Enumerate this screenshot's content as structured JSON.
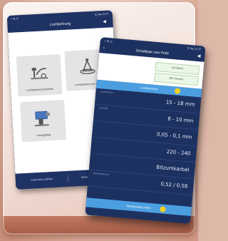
{
  "phone_left": {
    "status_left": "≈ ⊕ ⊙",
    "status_right": "◫ ▾▴ 11:27",
    "title": "Lochbohrung",
    "volume_icon": "speaker-icon",
    "tiles": [
      {
        "label": "Lochabstand Schalbrett",
        "icon": "pipe-bracket-icon"
      },
      {
        "label": "Lochabstand vom Profil",
        "icon": "profile-cone-icon"
      },
      {
        "label": "Kreisgebirge",
        "icon": "drill-machine-icon"
      }
    ],
    "bottom": {
      "left": "Laterstutzt wählen",
      "right": "Berechnungsmethode"
    }
  },
  "phone_right": {
    "status_left": "≈ ⊕ ⊙",
    "status_right": "◫ ▾▴ 11:27",
    "title": "Schalltippe vom Profil",
    "back_icon": "back-arrow-icon",
    "volume_icon": "speaker-icon",
    "fields": [
      {
        "label": "",
        "value": "Schalbrett"
      },
      {
        "label": "",
        "value": "WH Vorsicht"
      }
    ],
    "calc_label": "Lochbohrung",
    "results": [
      {
        "key": "Lochabstand",
        "value": "15 - 18 mm"
      },
      {
        "key": "Lochtiefe",
        "value": "8 - 10 mm"
      },
      {
        "key": "",
        "value": "0,05 - 0,1 mm"
      },
      {
        "key": "",
        "value": "220 - 240"
      },
      {
        "key": "",
        "value": "Bitzumkarbel"
      },
      {
        "key": "Drehzahlbereich",
        "value": "0,52 / 0,58"
      }
    ],
    "bottom_label": "Machbarkeit prüfen"
  }
}
